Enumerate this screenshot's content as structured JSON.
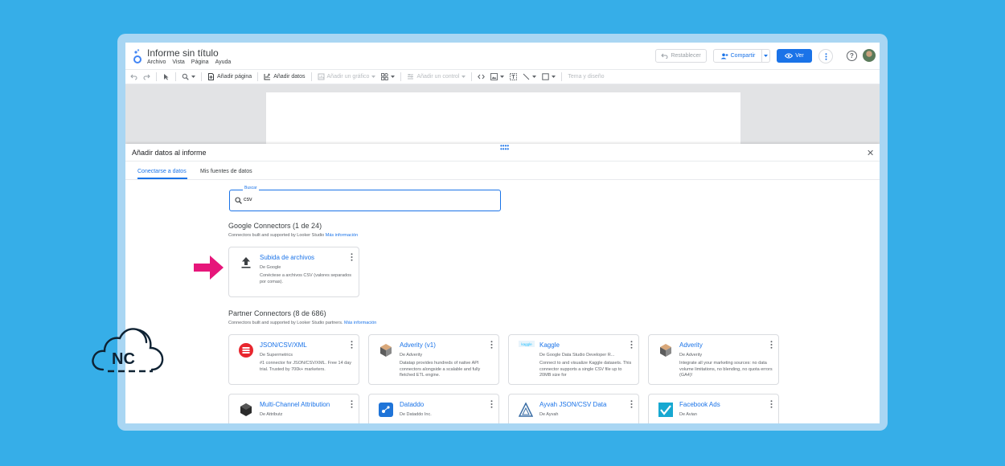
{
  "colors": {
    "background": "#36aee8",
    "accent": "#1a73e8",
    "arrow": "#e6167a"
  },
  "header": {
    "title": "Informe sin título",
    "menu": [
      "Archivo",
      "Vista",
      "Página",
      "Ayuda"
    ],
    "reset_label": "Restablecer",
    "share_label": "Compartir",
    "view_label": "Ver",
    "help_label": "?"
  },
  "toolbar": {
    "add_page": "Añadir página",
    "add_data": "Añadir datos",
    "add_chart": "Añadir un gráfico",
    "add_control": "Añadir un control",
    "theme": "Tema y diseño"
  },
  "panel": {
    "title": "Añadir datos al informe",
    "tabs": [
      "Conectarse a datos",
      "Mis fuentes de datos"
    ],
    "search": {
      "label": "Buscar",
      "value": "csv"
    },
    "google": {
      "title": "Google Connectors (1 de 24)",
      "subtitle": "Connectors built and supported by Looker Studio",
      "more": "Más información",
      "cards": [
        {
          "title": "Subida de archivos",
          "by": "De Google",
          "desc": "Conéctese a archivos CSV (valores separados por comas).",
          "icon": "upload-icon"
        }
      ]
    },
    "partner": {
      "title": "Partner Connectors (8 de 686)",
      "subtitle": "Connectors built and supported by Looker Studio partners.",
      "more": "Más información",
      "cards": [
        {
          "title": "JSON/CSV/XML",
          "by": "De Supermetrics",
          "desc": "#1 connector for JSON/CSV/XML. Free 14 day trial. Trusted by 700k+ marketers.",
          "icon": "supermetrics-icon"
        },
        {
          "title": "Adverity (v1)",
          "by": "De Adverity",
          "desc": "Datatap provides hundreds of native API connectors alongside a scalable and fully fletched ETL engine.",
          "icon": "adverity-icon"
        },
        {
          "title": "Kaggle",
          "by": "De Google Data Studio Developer R...",
          "desc": "Connect to and visualize Kaggle datasets. This connector supports a single CSV file up to 20MB size for",
          "icon": "kaggle-icon",
          "badge": "kaggle"
        },
        {
          "title": "Adverity",
          "by": "De Adverity",
          "desc": "Integrate all your marketing sources: no data volume limitations, no blending, no quota errors (GA4)!",
          "icon": "adverity-icon"
        },
        {
          "title": "Multi-Channel Attribution",
          "by": "De Attributz",
          "desc": "",
          "icon": "attributz-icon"
        },
        {
          "title": "Dataddo",
          "by": "De Dataddo Inc.",
          "desc": "",
          "icon": "dataddo-icon"
        },
        {
          "title": "Ayvah JSON/CSV Data",
          "by": "De Ayvah",
          "desc": "",
          "icon": "ayvah-icon"
        },
        {
          "title": "Facebook Ads",
          "by": "De Avian",
          "desc": "",
          "icon": "facebook-ads-icon"
        }
      ]
    }
  },
  "brand": {
    "logo_text": "NC"
  }
}
